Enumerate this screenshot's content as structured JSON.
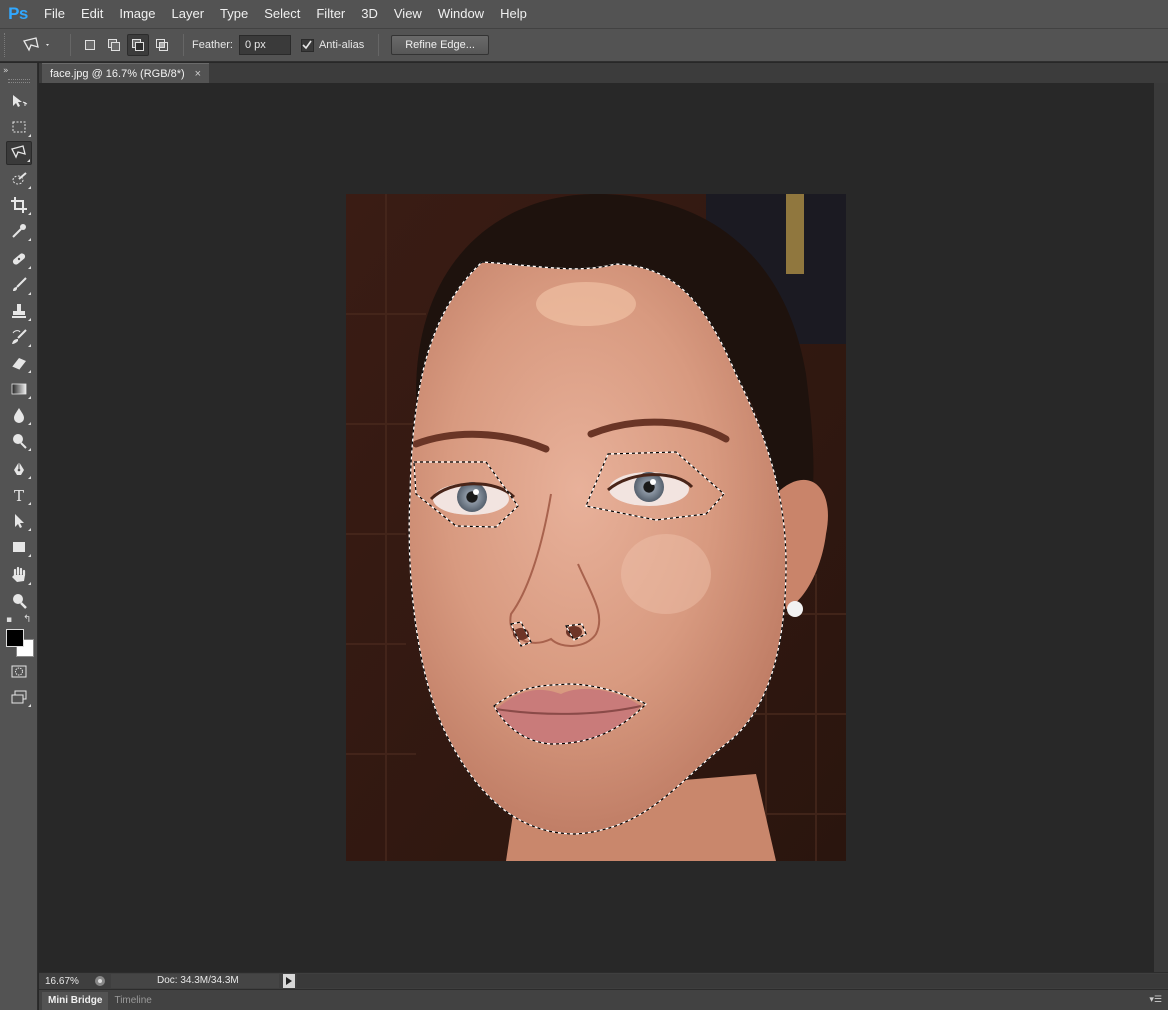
{
  "app": {
    "logo": "Ps",
    "menu": [
      "File",
      "Edit",
      "Image",
      "Layer",
      "Type",
      "Select",
      "Filter",
      "3D",
      "View",
      "Window",
      "Help"
    ]
  },
  "options_bar": {
    "tool_preset_icon": "polygonal-lasso-icon",
    "selection_modes": [
      "new-selection",
      "add-to-selection",
      "subtract-from-selection",
      "intersect-with-selection"
    ],
    "active_mode": "subtract-from-selection",
    "feather_label": "Feather:",
    "feather_value": "0 px",
    "anti_alias_label": "Anti-alias",
    "anti_alias_checked": true,
    "refine_edge_label": "Refine Edge..."
  },
  "document": {
    "tab_title": "face.jpg @ 16.7% (RGB/8*)",
    "close_glyph": "×",
    "image_description_subject": "portrait photo with marching-ants selection around face, eyes, nostrils and lips"
  },
  "tools": [
    "move",
    "rectangular-marquee",
    "polygonal-lasso",
    "quick-selection",
    "crop",
    "eyedropper",
    "spot-healing-brush",
    "brush",
    "clone-stamp",
    "history-brush",
    "eraser",
    "gradient",
    "blur",
    "dodge",
    "pen",
    "type",
    "path-selection",
    "rectangle",
    "hand",
    "zoom"
  ],
  "active_tool": "polygonal-lasso",
  "colors": {
    "foreground": "#000000",
    "background": "#ffffff",
    "accent": "#31a8ff"
  },
  "status_bar": {
    "zoom": "16.67%",
    "doc_info": "Doc: 34.3M/34.3M"
  },
  "bottom_panels": {
    "tabs": [
      "Mini Bridge",
      "Timeline"
    ],
    "active": "Mini Bridge"
  }
}
